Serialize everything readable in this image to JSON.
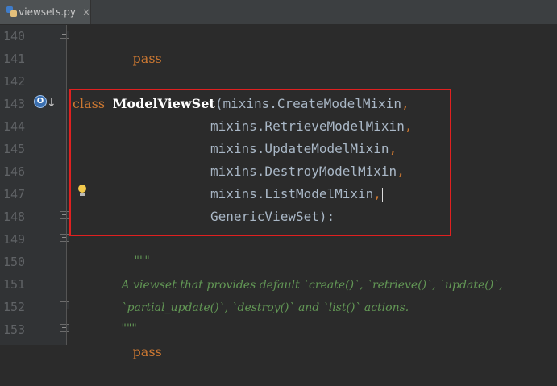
{
  "tab": {
    "filename": "viewsets.py",
    "close_glyph": "×"
  },
  "icons": {
    "file": "python-file-icon",
    "override": "override-marker-icon",
    "bulb": "intention-bulb-icon"
  },
  "colors": {
    "keyword": "#cc7832",
    "class_name": "#ffffff",
    "docstring": "#629755",
    "line_number": "#606366",
    "highlight_box": "#e02020"
  },
  "override_marker": "O",
  "lines": [
    {
      "num": "140",
      "parts": []
    },
    {
      "num": "141",
      "parts": []
    },
    {
      "num": "142",
      "parts": []
    },
    {
      "num": "143",
      "parts": []
    },
    {
      "num": "144",
      "parts": []
    },
    {
      "num": "145",
      "parts": []
    },
    {
      "num": "146",
      "parts": []
    },
    {
      "num": "147",
      "parts": []
    },
    {
      "num": "148",
      "parts": []
    },
    {
      "num": "149",
      "parts": []
    },
    {
      "num": "150",
      "parts": []
    },
    {
      "num": "151",
      "parts": []
    },
    {
      "num": "152",
      "parts": []
    },
    {
      "num": "153",
      "parts": []
    }
  ],
  "code": {
    "l140": {
      "kw": "pass"
    },
    "l143": {
      "kw": "class",
      "name": "ModelViewSet",
      "open": "(",
      "base": "mixins.CreateModelMixin",
      "comma": ","
    },
    "l144": {
      "base": "mixins.RetrieveModelMixin",
      "comma": ","
    },
    "l145": {
      "base": "mixins.UpdateModelMixin",
      "comma": ","
    },
    "l146": {
      "base": "mixins.DestroyModelMixin",
      "comma": ","
    },
    "l147": {
      "base": "mixins.ListModelMixin",
      "comma": ","
    },
    "l148": {
      "base": "GenericViewSet",
      "close": "):"
    },
    "l149": {
      "doc": "\"\"\""
    },
    "l150": {
      "doc": "A viewset that provides default `create()`, `retrieve()`, `update()`,"
    },
    "l151": {
      "doc": "`partial_update()`, `destroy()` and `list()` actions."
    },
    "l152": {
      "doc": "\"\"\""
    },
    "l153": {
      "kw": "pass"
    }
  }
}
